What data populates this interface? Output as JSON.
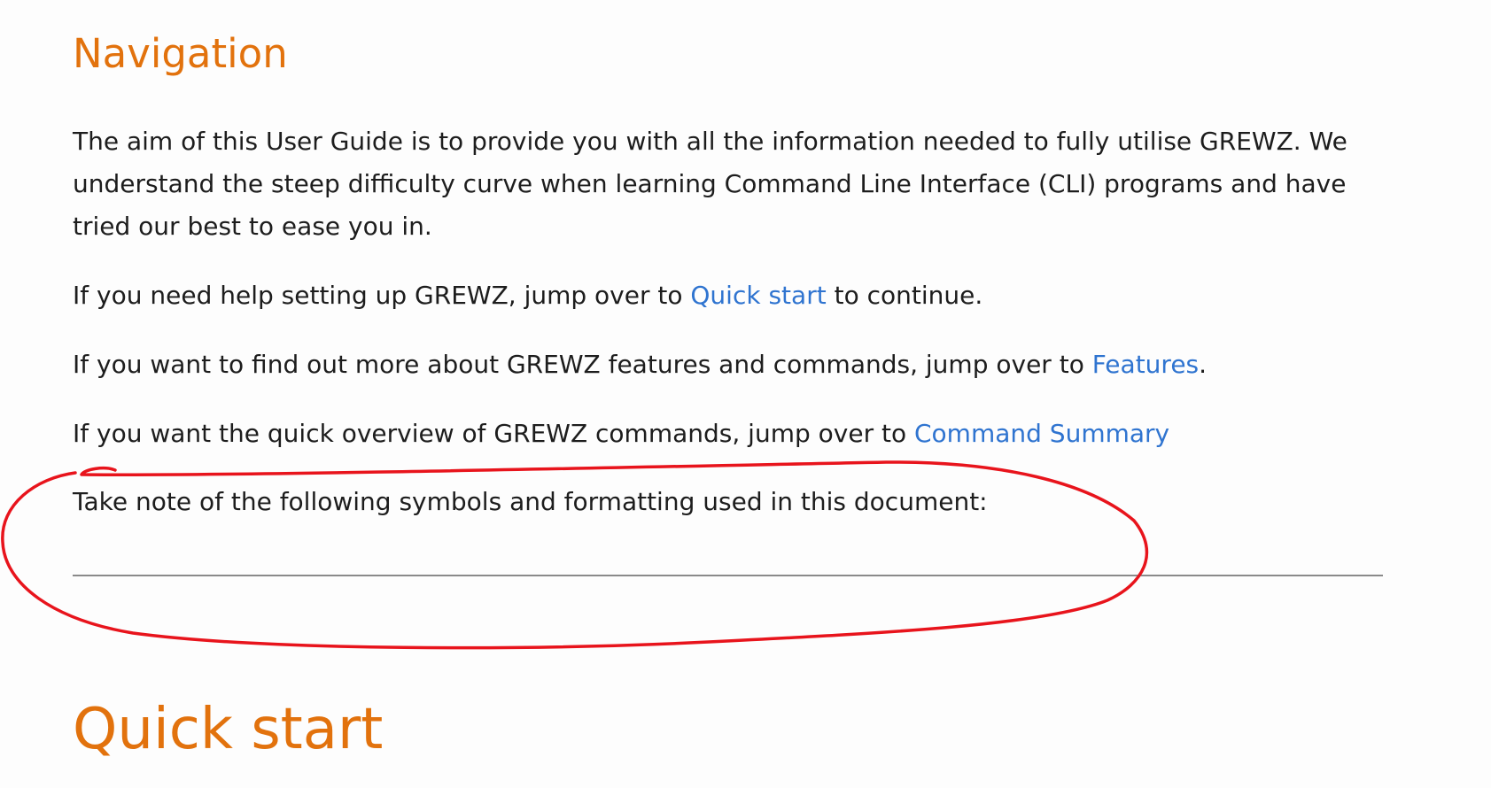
{
  "navigation": {
    "heading": "Navigation",
    "intro_line1": "The aim of this User Guide is to provide you with all the information needed to fully utilise GREWZ. We",
    "intro_line2": "understand the steep difficulty curve when learning Command Line Interface (CLI) programs and have",
    "intro_line3": "tried our best to ease you in.",
    "setup_prefix": "If you need help setting up GREWZ, jump over to ",
    "setup_link": "Quick start",
    "setup_suffix": " to continue.",
    "features_prefix": "If you want to find out more about GREWZ features and commands, jump over to ",
    "features_link": "Features",
    "features_suffix": ".",
    "summary_prefix": "If you want the quick overview of GREWZ commands, jump over to ",
    "summary_link": "Command Summary",
    "note": "Take note of the following symbols and formatting used in this document:"
  },
  "quick_start": {
    "heading": "Quick start"
  },
  "colors": {
    "heading": "#e2720d",
    "link": "#2f74d0",
    "body_text": "#1d1d1d",
    "annotation": "#e8141c",
    "rule": "#8a8a8a"
  }
}
